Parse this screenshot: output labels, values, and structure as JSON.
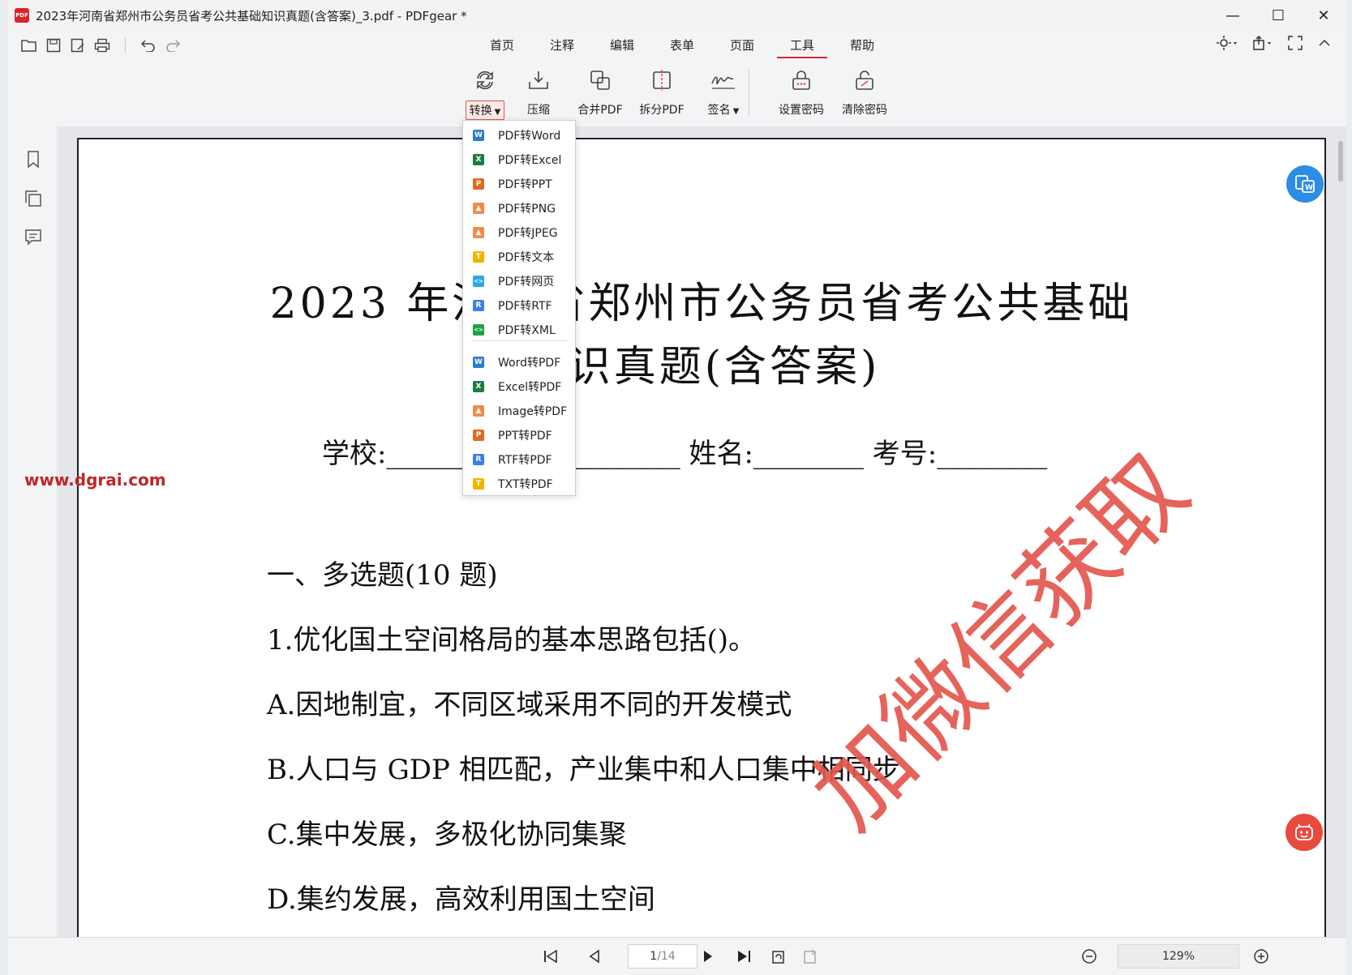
{
  "window": {
    "title": "2023年河南省郑州市公务员省考公共基础知识真题(含答案)_3.pdf - PDFgear *",
    "app_icon_text": "PDF",
    "minimize": "—",
    "maximize": "☐",
    "close": "✕"
  },
  "menu": {
    "tabs": [
      {
        "label": "首页"
      },
      {
        "label": "注释"
      },
      {
        "label": "编辑"
      },
      {
        "label": "表单"
      },
      {
        "label": "页面"
      },
      {
        "label": "工具"
      },
      {
        "label": "帮助"
      }
    ],
    "active_tab": "工具"
  },
  "ribbon": {
    "convert": "转换",
    "compress": "压缩",
    "merge": "合并PDF",
    "split": "拆分PDF",
    "sign": "签名",
    "set_password": "设置密码",
    "remove_password": "清除密码"
  },
  "dropdown": {
    "items": [
      {
        "label": "PDF转Word",
        "badge": "W",
        "color": "#2b7cd3"
      },
      {
        "label": "PDF转Excel",
        "badge": "X",
        "color": "#1e7b45"
      },
      {
        "label": "PDF转PPT",
        "badge": "P",
        "color": "#e06a1f"
      },
      {
        "label": "PDF转PNG",
        "badge": "▲",
        "color": "#f08a4b"
      },
      {
        "label": "PDF转JPEG",
        "badge": "▲",
        "color": "#f08a4b"
      },
      {
        "label": "PDF转文本",
        "badge": "T",
        "color": "#f5b400"
      },
      {
        "label": "PDF转网页",
        "badge": "<>",
        "color": "#2ea9e6"
      },
      {
        "label": "PDF转RTF",
        "badge": "R",
        "color": "#3f7ee8"
      },
      {
        "label": "PDF转XML",
        "badge": "<>",
        "color": "#1fa04a"
      },
      {
        "label": "Word转PDF",
        "badge": "W",
        "color": "#2b7cd3"
      },
      {
        "label": "Excel转PDF",
        "badge": "X",
        "color": "#1e7b45"
      },
      {
        "label": "Image转PDF",
        "badge": "▲",
        "color": "#f08a4b"
      },
      {
        "label": "PPT转PDF",
        "badge": "P",
        "color": "#e06a1f"
      },
      {
        "label": "RTF转PDF",
        "badge": "R",
        "color": "#3f7ee8"
      },
      {
        "label": "TXT转PDF",
        "badge": "T",
        "color": "#f5b400"
      }
    ]
  },
  "document": {
    "title_line1": "2023 年河南省郑州市公务员省考公共基础",
    "title_line2": "知识真题(含答案)",
    "fields": "学校:________ 班级:________ 姓名:________ 考号:________",
    "section": "一、多选题(10 题)",
    "question": "1.优化国土空间格局的基本思路包括()。",
    "options": [
      "A.因地制宜，不同区域采用不同的开发模式",
      "B.人口与 GDP 相匹配，产业集中和人口集中相同步",
      "C.集中发展，多极化协同集聚",
      "D.集约发展，高效利用国土空间"
    ],
    "watermark": "加微信获取",
    "site_watermark": "www.dgrai.com"
  },
  "status": {
    "page_current": "1",
    "page_total": "/14",
    "zoom": "129%"
  },
  "colors": {
    "accent": "#d9262c",
    "watermark": "#e3564e",
    "float_blue": "#2d8ce6",
    "float_red": "#e84a3f"
  }
}
